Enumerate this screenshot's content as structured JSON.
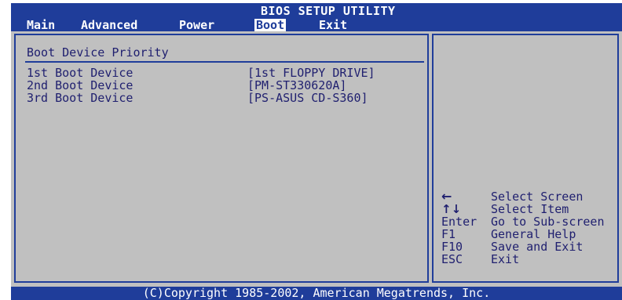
{
  "header": {
    "title": "BIOS SETUP UTILITY",
    "tabs": [
      {
        "label": "Main"
      },
      {
        "label": "Advanced"
      },
      {
        "label": "Power"
      },
      {
        "label": "Boot"
      },
      {
        "label": "Exit"
      }
    ],
    "selected_tab": "Boot"
  },
  "section": {
    "title": "Boot Device Priority",
    "items": [
      {
        "label": "1st Boot Device",
        "value": "[1st FLOPPY DRIVE]"
      },
      {
        "label": "2nd Boot Device",
        "value": "[PM-ST330620A]"
      },
      {
        "label": "3rd Boot Device",
        "value": "[PS-ASUS CD-S360]"
      }
    ]
  },
  "help": [
    {
      "key": "←",
      "desc": "Select Screen",
      "icon": "left-arrow-icon"
    },
    {
      "key": "↑↓",
      "desc": "Select Item",
      "icon": "up-down-arrow-icon"
    },
    {
      "key": "Enter",
      "desc": "Go to Sub-screen"
    },
    {
      "key": "F1",
      "desc": "General Help"
    },
    {
      "key": "F10",
      "desc": "Save and Exit"
    },
    {
      "key": "ESC",
      "desc": "Exit"
    }
  ],
  "footer": {
    "copyright": "(C)Copyright 1985-2002, American Megatrends, Inc."
  },
  "colors": {
    "bar_blue": "#1f3d9a",
    "panel_grey": "#c0c0c0",
    "text_navy": "#1f1f6f",
    "white": "#ffffff"
  }
}
